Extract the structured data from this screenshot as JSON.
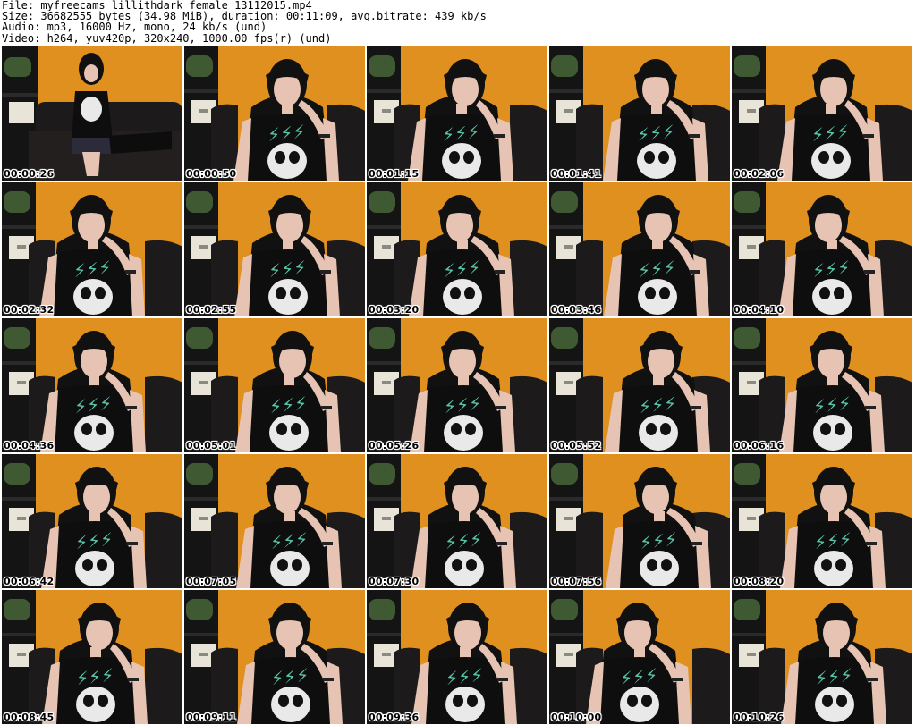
{
  "header": {
    "file_line": "File: myfreecams_lillithdark_female_13112015.mp4",
    "size_line": "Size: 36682555 bytes (34.98 MiB), duration: 00:11:09, avg.bitrate: 439 kb/s",
    "audio_line": "Audio: mp3, 16000 Hz, mono, 24 kb/s (und)",
    "video_line": "Video: h264, yuv420p, 320x240, 1000.00 fps(r) (und)"
  },
  "thumbnails": [
    {
      "timestamp": "00:00:26"
    },
    {
      "timestamp": "00:00:50"
    },
    {
      "timestamp": "00:01:15"
    },
    {
      "timestamp": "00:01:41"
    },
    {
      "timestamp": "00:02:06"
    },
    {
      "timestamp": "00:02:32"
    },
    {
      "timestamp": "00:02:55"
    },
    {
      "timestamp": "00:03:20"
    },
    {
      "timestamp": "00:03:46"
    },
    {
      "timestamp": "00:04:10"
    },
    {
      "timestamp": "00:04:36"
    },
    {
      "timestamp": "00:05:01"
    },
    {
      "timestamp": "00:05:26"
    },
    {
      "timestamp": "00:05:52"
    },
    {
      "timestamp": "00:06:16"
    },
    {
      "timestamp": "00:06:42"
    },
    {
      "timestamp": "00:07:05"
    },
    {
      "timestamp": "00:07:30"
    },
    {
      "timestamp": "00:07:56"
    },
    {
      "timestamp": "00:08:20"
    },
    {
      "timestamp": "00:08:45"
    },
    {
      "timestamp": "00:09:11"
    },
    {
      "timestamp": "00:09:36"
    },
    {
      "timestamp": "00:10:00"
    },
    {
      "timestamp": "00:10:26"
    }
  ],
  "colors": {
    "wall": "#e0901e",
    "couch": "#1c1a1a",
    "shelf": "#141414",
    "box": "#e8e4d8",
    "plant": "#3f5a33",
    "hair": "#111111",
    "skin": "#e6c3b2",
    "shirt": "#0e0e0e",
    "print": "#59c4a7",
    "skull": "#e9e9e9"
  }
}
